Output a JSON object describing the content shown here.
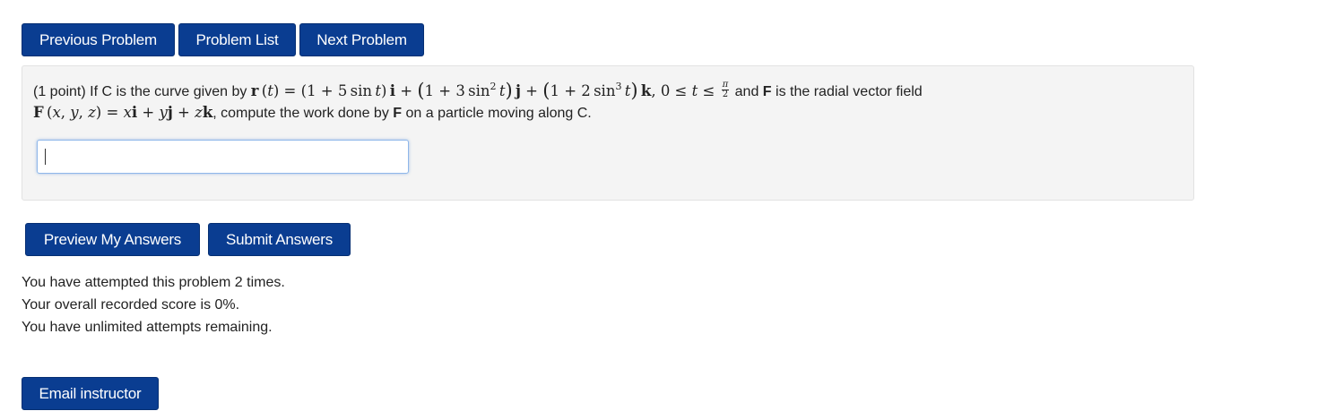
{
  "nav": {
    "previous_label": "Previous Problem",
    "list_label": "Problem List",
    "next_label": "Next Problem"
  },
  "problem": {
    "points": "(1 point)",
    "intro": "If C is the curve given by",
    "mid_text": "and",
    "field_symbol": "F",
    "mid_text2": "is the radial vector field",
    "line2_text": ", compute the work done by",
    "line2_field": "F",
    "line2_end": "on a particle moving along C."
  },
  "answer": {
    "value": "",
    "placeholder": ""
  },
  "actions": {
    "preview_label": "Preview My Answers",
    "submit_label": "Submit Answers"
  },
  "status": {
    "attempts": "You have attempted this problem 2 times.",
    "score": "Your overall recorded score is 0%.",
    "remaining": "You have unlimited attempts remaining."
  },
  "footer": {
    "email_label": "Email instructor"
  },
  "colors": {
    "button_bg": "#0a3d91",
    "problem_bg": "#f4f4f4"
  }
}
